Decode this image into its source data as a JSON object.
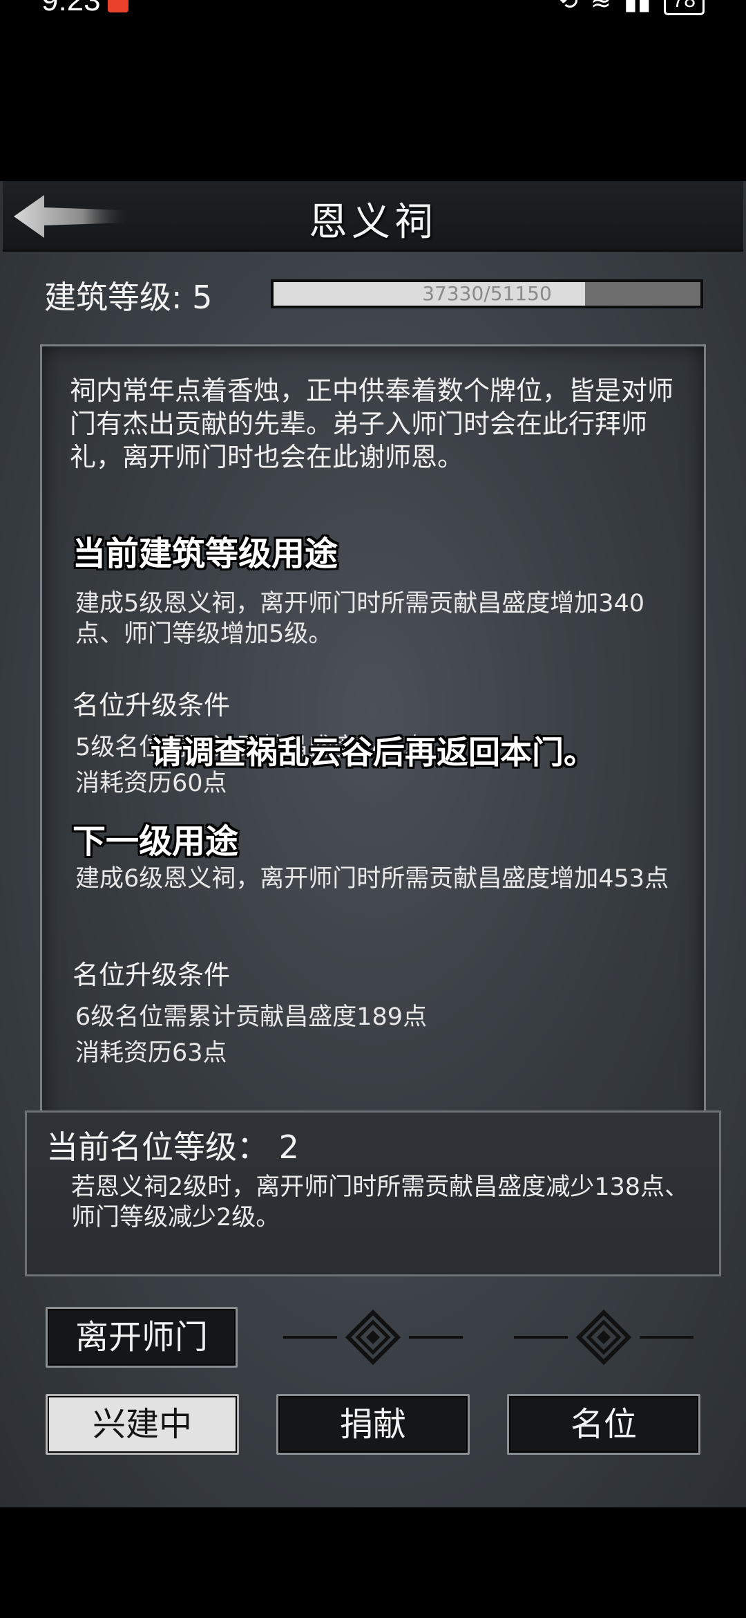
{
  "status_bar": {
    "time": "9:23",
    "battery": "78"
  },
  "header": {
    "title": "恩义祠"
  },
  "building": {
    "level_label": "建筑等级: 5",
    "progress_text": "37330/51150",
    "progress_fraction": 0.7298
  },
  "description": "祠内常年点着香烛，正中供奉着数个牌位，皆是对师门有杰出贡献的先辈。弟子入师门时会在此行拜师礼，离开师门时也会在此谢师恩。",
  "current": {
    "heading": "当前建筑等级用途",
    "usage": "建成5级恩义祠，离开师门时所需贡献昌盛度增加340点、师门等级增加5级。",
    "rank_heading": "名位升级条件",
    "rank_req_1": "5级名位需累计贡献昌盛度141点",
    "rank_req_2": "消耗资历60点"
  },
  "next": {
    "heading": "下一级用途",
    "usage": "建成6级恩义祠，离开师门时所需贡献昌盛度增加453点",
    "rank_heading": "名位升级条件",
    "rank_req_1": "6级名位需累计贡献昌盛度189点",
    "rank_req_2": "消耗资历63点"
  },
  "overlay_message": "请调查祸乱云谷后再返回本门。",
  "rank_panel": {
    "title": "当前名位等级：  2",
    "desc": "若恩义祠2级时，离开师门时所需贡献昌盛度减少138点、师门等级减少2级。"
  },
  "buttons": {
    "leave": "离开师门",
    "building": "兴建中",
    "donate": "捐献",
    "rank": "名位"
  },
  "icons": {
    "back": "back-arrow-icon",
    "ornament": "diamond-ornament-icon"
  },
  "colors": {
    "accent_light": "#e2e2e2",
    "panel_border": "#7a7f84",
    "button_bg": "#141618"
  }
}
